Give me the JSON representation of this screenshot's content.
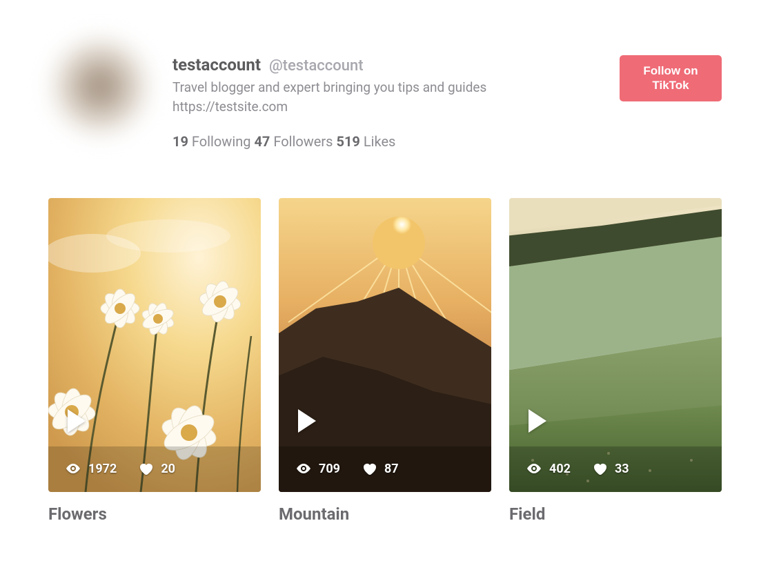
{
  "profile": {
    "display_name": "testaccount",
    "handle": "@testaccount",
    "bio": "Travel blogger and expert bringing you tips and guides",
    "link": "https://testsite.com",
    "following_count": "19",
    "following_label": "Following",
    "followers_count": "47",
    "followers_label": "Followers",
    "likes_count": "519",
    "likes_label": "Likes"
  },
  "follow_button": {
    "line1": "Follow on",
    "line2": "TikTok"
  },
  "posts": [
    {
      "title": "Flowers",
      "views": "1972",
      "likes": "20"
    },
    {
      "title": "Mountain",
      "views": "709",
      "likes": "87"
    },
    {
      "title": "Field",
      "views": "402",
      "likes": "33"
    }
  ]
}
